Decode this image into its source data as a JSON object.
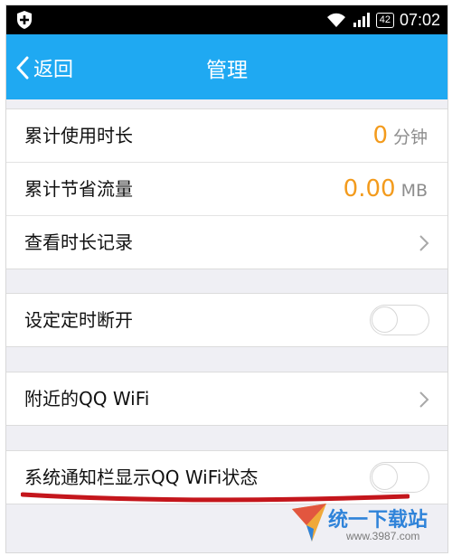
{
  "status_bar": {
    "time": "07:02",
    "battery": "42",
    "icons": [
      "shield-icon",
      "wifi-icon",
      "signal-icon",
      "battery-icon"
    ]
  },
  "nav": {
    "back_label": "返回",
    "title": "管理"
  },
  "stats": {
    "usage_label": "累计使用时长",
    "usage_value": "0",
    "usage_unit": "分钟",
    "saved_label": "累计节省流量",
    "saved_value": "0.00",
    "saved_unit": "MB",
    "history_label": "查看时长记录"
  },
  "timer": {
    "label": "设定定时断开",
    "enabled": false
  },
  "nearby": {
    "label": "附近的QQ WiFi"
  },
  "notify": {
    "label": "系统通知栏显示QQ WiFi状态",
    "enabled": false
  },
  "watermark": {
    "text": "统一下载站",
    "url": "www.3987.com"
  },
  "colors": {
    "accent": "#1fa9f2",
    "value": "#f39b1d",
    "annotation": "#c4161c"
  }
}
